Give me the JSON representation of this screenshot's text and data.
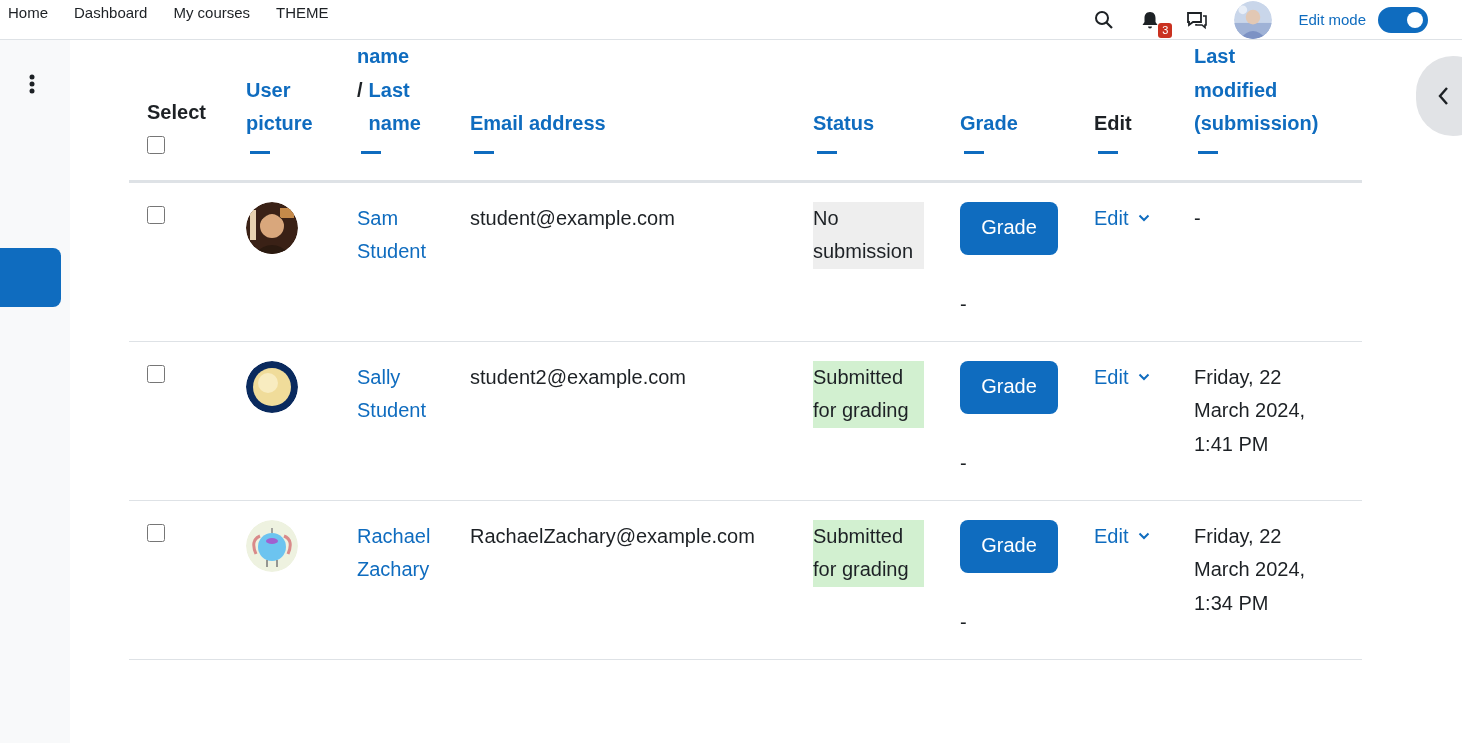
{
  "navbar": {
    "breadcrumbs": [
      "Home",
      "Dashboard",
      "My courses",
      "THEME"
    ],
    "notification_count": "3",
    "edit_mode": {
      "label": "Edit mode",
      "on": true
    }
  },
  "table": {
    "select_header": {
      "label": "Select",
      "checked": false
    },
    "columns": [
      {
        "kind": "link",
        "lines": [
          "User picture"
        ]
      },
      {
        "kind": "name",
        "first": "name",
        "separator": "/",
        "last": "Last name"
      },
      {
        "kind": "link",
        "lines": [
          "Email address"
        ]
      },
      {
        "kind": "link",
        "lines": [
          "Status"
        ]
      },
      {
        "kind": "link",
        "lines": [
          "Grade"
        ]
      },
      {
        "kind": "plain",
        "lines": [
          "Edit"
        ]
      },
      {
        "kind": "link",
        "lines": [
          "Last modified (submission)"
        ]
      }
    ],
    "rows": [
      {
        "checked": false,
        "name": "Sam Student",
        "email": "student@example.com",
        "status": {
          "text": "No submission",
          "color": "#eeeeee"
        },
        "grade_button": "Grade",
        "grade": "-",
        "edit": "Edit",
        "last_modified": "-"
      },
      {
        "checked": false,
        "name": "Sally Student",
        "email": "student2@example.com",
        "status": {
          "text": "Submitted for grading",
          "color": "#d2f0d0"
        },
        "grade_button": "Grade",
        "grade": "-",
        "edit": "Edit",
        "last_modified": "Friday, 22 March 2024, 1:41 PM"
      },
      {
        "checked": false,
        "name": "Rachael Zachary",
        "email": "RachaelZachary@example.com",
        "status": {
          "text": "Submitted for grading",
          "color": "#d2f0d0"
        },
        "grade_button": "Grade",
        "grade": "-",
        "edit": "Edit",
        "last_modified": "Friday, 22 March 2024, 1:34 PM"
      }
    ]
  }
}
